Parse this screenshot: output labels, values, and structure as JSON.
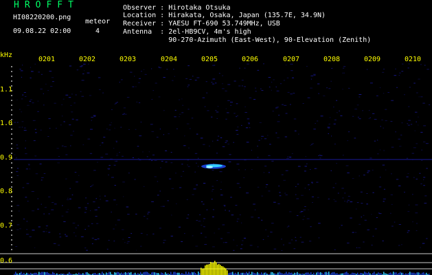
{
  "header": {
    "app_title": "HROFFT",
    "filename": "HI08220200.png",
    "datetime": "09.08.22 02:00",
    "meteor_label": "meteor",
    "meteor_count": "4"
  },
  "station": {
    "observer": "Observer : Hirotaka Otsuka",
    "location": "Location : Hirakata, Osaka, Japan (135.7E, 34.9N)",
    "receiver": "Receiver : YAESU FT-690 53.749MHz, USB",
    "antenna": "Antenna  : 2el-HB9CV, 4m's high",
    "antenna2": "           90-270-Azimuth (East-West), 90-Elevation (Zenith)"
  },
  "axis": {
    "unit": "kHz",
    "y_ticks": [
      "1.1",
      "1.0",
      "0.9",
      "0.8",
      "0.7",
      "0.6"
    ],
    "x_ticks": [
      "0201",
      "0202",
      "0203",
      "0204",
      "0205",
      "0206",
      "0207",
      "0208",
      "0209",
      "0210"
    ]
  },
  "colors": {
    "background": "#000000",
    "title": "#00ff66",
    "text": "#ffffff",
    "ticks": "#ffff00",
    "noise": "#1a1a9a",
    "echo": "#33ccff",
    "spectrum": "#ffff00"
  }
}
